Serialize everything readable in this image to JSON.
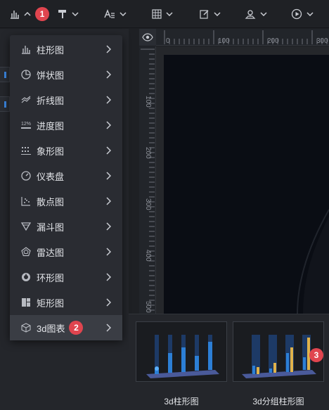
{
  "toolbar": {
    "badge_step": "1",
    "items": [
      "chart-type",
      "format-painter",
      "text-style",
      "table",
      "edit",
      "map-pin",
      "play"
    ]
  },
  "ruler": {
    "top_labels": [
      "0",
      "100",
      "200",
      "300"
    ],
    "left_labels": [
      "100",
      "200",
      "300",
      "400",
      "500"
    ]
  },
  "menu": {
    "items": [
      {
        "label": "柱形图",
        "icon": "bar-chart-icon"
      },
      {
        "label": "饼状图",
        "icon": "pie-chart-icon"
      },
      {
        "label": "折线图",
        "icon": "line-chart-icon"
      },
      {
        "label": "进度图",
        "icon": "progress-chart-icon"
      },
      {
        "label": "象形图",
        "icon": "pictograph-icon"
      },
      {
        "label": "仪表盘",
        "icon": "gauge-icon"
      },
      {
        "label": "散点图",
        "icon": "scatter-chart-icon"
      },
      {
        "label": "漏斗图",
        "icon": "funnel-chart-icon"
      },
      {
        "label": "雷达图",
        "icon": "radar-chart-icon"
      },
      {
        "label": "环形图",
        "icon": "ring-chart-icon"
      },
      {
        "label": "矩形图",
        "icon": "treemap-icon"
      },
      {
        "label": "3d图表",
        "icon": "cube-icon"
      }
    ],
    "active_badge": "2"
  },
  "flyout": {
    "charts": [
      {
        "label": "3d柱形图"
      },
      {
        "label": "3d分组柱形图"
      }
    ],
    "badge": "3"
  },
  "colors": {
    "accent": "#3a86e0",
    "badge": "#e0454f",
    "menu_bg": "#2a2c32"
  }
}
